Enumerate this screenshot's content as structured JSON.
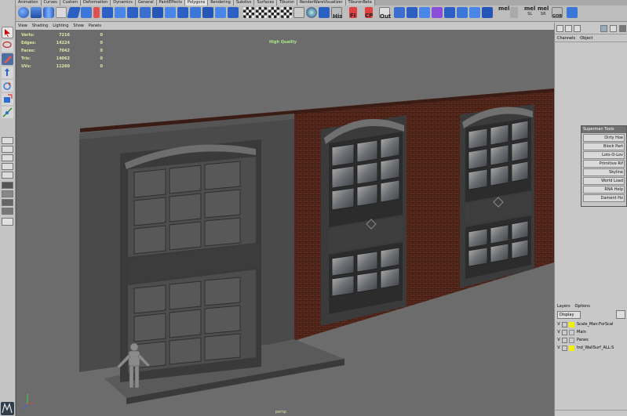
{
  "shelf_tabs": [
    "Animation",
    "Curves",
    "Custom",
    "Deformation",
    "Dynamics",
    "General",
    "PaintEffects",
    "Polygons",
    "Rendering",
    "Subdivs",
    "Surfaces",
    "Tiburon",
    "RenderWareVisualizer",
    "TiburonBeta"
  ],
  "shelf_active": "Polygons",
  "shelf_mel_buttons": [
    {
      "label": "",
      "sub": "His"
    },
    {
      "label": "",
      "sub": "FI"
    },
    {
      "label": "",
      "sub": "CP"
    },
    {
      "label": "",
      "sub": "Out"
    },
    {
      "label": "mel",
      "sub": ""
    },
    {
      "label": "mel",
      "sub": "SL"
    },
    {
      "label": "mel",
      "sub": "SR"
    },
    {
      "label": "",
      "sub": "GOB"
    }
  ],
  "panel_menu": [
    "View",
    "Shading",
    "Lighting",
    "Show",
    "Panels"
  ],
  "hud": {
    "rows": [
      {
        "label": "Verts:",
        "v1": "7216",
        "v2": "0"
      },
      {
        "label": "Edges:",
        "v1": "14224",
        "v2": "0"
      },
      {
        "label": "Faces:",
        "v1": "7042",
        "v2": "0"
      },
      {
        "label": "Tris:",
        "v1": "14062",
        "v2": "0"
      },
      {
        "label": "UVs:",
        "v1": "11260",
        "v2": "0"
      }
    ],
    "quality": "High Quality",
    "camera": "persp"
  },
  "channel_box": {
    "menu": [
      "Channels",
      "Object"
    ]
  },
  "superman_tools": {
    "title": "Superman Tools",
    "buttons": [
      "Dirty Hoe",
      "Block Part",
      "Lots-O-Lov",
      "Primitive Rif",
      "Skyline",
      "World Load",
      "RNA Help",
      "Dament Ho"
    ]
  },
  "layers": {
    "menu": [
      "Layers",
      "Options"
    ],
    "display": "Display",
    "items": [
      {
        "v": "V",
        "name": "Scale_Man:ForScal",
        "color": "#f0f000"
      },
      {
        "v": "V",
        "name": "Main",
        "color": ""
      },
      {
        "v": "V",
        "name": "Panes",
        "color": ""
      },
      {
        "v": "V",
        "name": "Ind_WallSurf_ALL:S",
        "color": "#f0f000"
      }
    ]
  },
  "colors": {
    "viewport_bg": "#6c6c6c",
    "brick": "#5a2a1f",
    "hud_text": "#e6e6b0",
    "quality_text": "#a8e888"
  }
}
